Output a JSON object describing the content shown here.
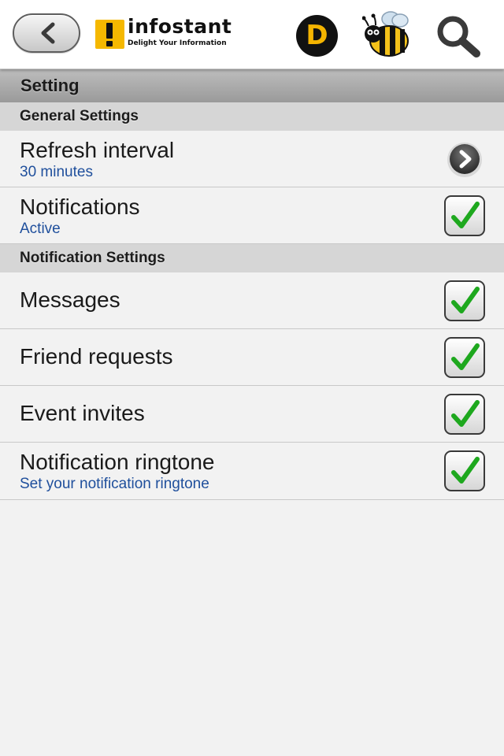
{
  "header": {
    "logo_name": "infostant",
    "logo_tagline": "Delight Your Information",
    "d_badge": "D"
  },
  "page_title": "Setting",
  "sections": [
    {
      "label": "General Settings",
      "rows": [
        {
          "title": "Refresh interval",
          "subtitle": "30 minutes",
          "control": "chevron"
        },
        {
          "title": "Notifications",
          "subtitle": "Active",
          "control": "checkbox",
          "checked": true
        }
      ]
    },
    {
      "label": "Notification Settings",
      "rows": [
        {
          "title": "Messages",
          "control": "checkbox",
          "checked": true
        },
        {
          "title": "Friend requests",
          "control": "checkbox",
          "checked": true
        },
        {
          "title": "Event invites",
          "control": "checkbox",
          "checked": true
        },
        {
          "title": "Notification ringtone",
          "subtitle": "Set your notification ringtone",
          "control": "checkbox",
          "checked": true
        }
      ]
    }
  ],
  "colors": {
    "subtitle": "#1f4f9c",
    "checkmark": "#1ea81e",
    "logo_accent": "#f5b800"
  },
  "icons": [
    "back-chevron-icon",
    "infostant-logo-icon",
    "d-badge-icon",
    "bee-icon",
    "search-icon",
    "chevron-right-icon",
    "checkmark-icon"
  ]
}
